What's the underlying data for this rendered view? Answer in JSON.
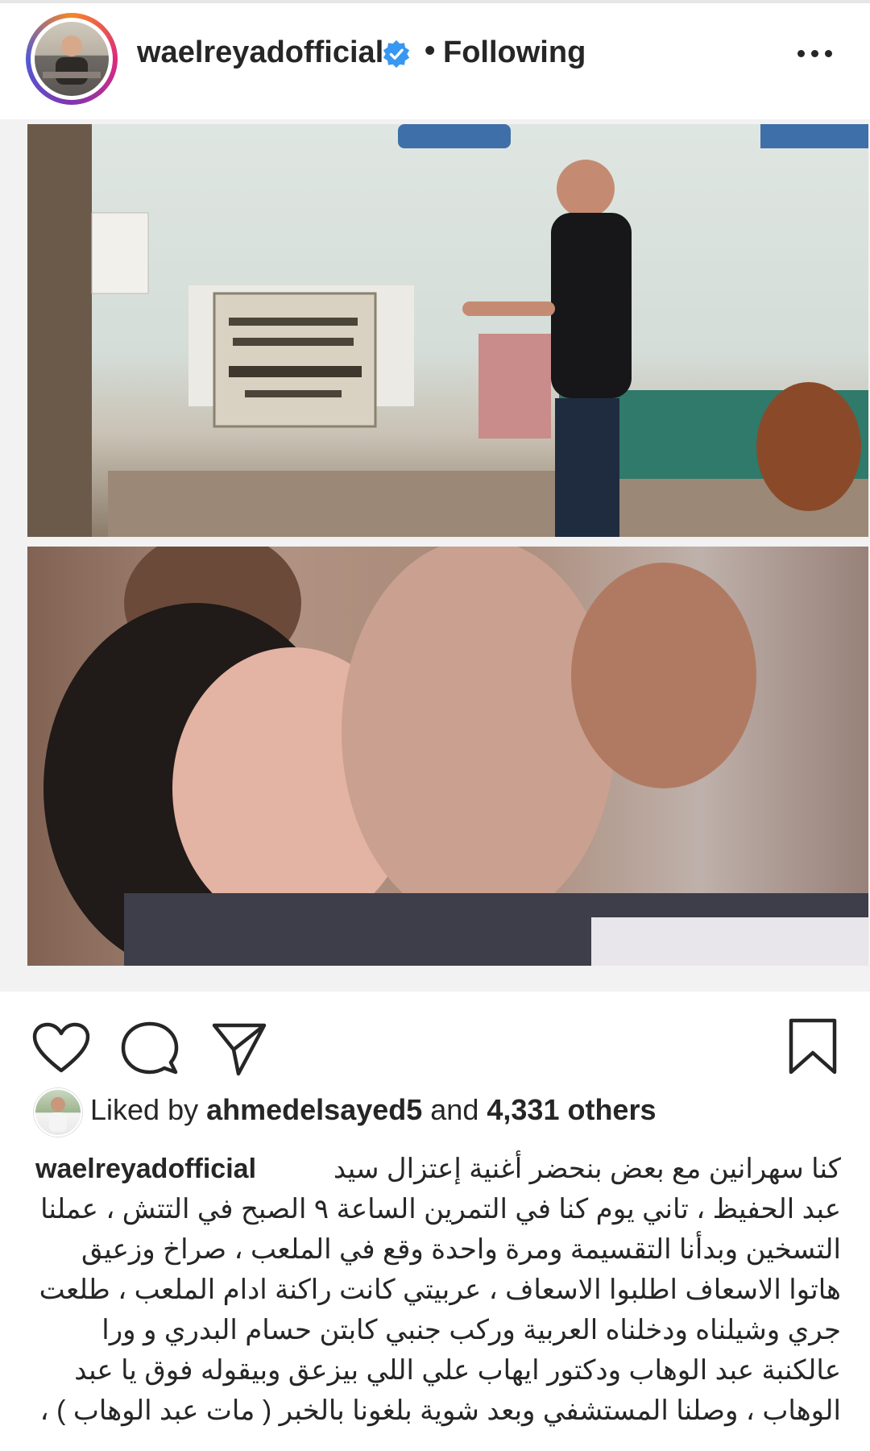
{
  "post": {
    "username": "waelreyadofficial",
    "separator": "•",
    "follow_status": "Following",
    "verified_icon": "verified-badge-icon",
    "more_icon": "more-options-icon"
  },
  "colors": {
    "verified": "#3897f0",
    "text": "#262626"
  },
  "actions": {
    "like_icon": "heart-icon",
    "comment_icon": "comment-icon",
    "share_icon": "send-icon",
    "save_icon": "bookmark-icon"
  },
  "likes": {
    "prefix": "Liked by",
    "user": "ahmedelsayed5",
    "joiner": "and",
    "count": "4,331 others"
  },
  "caption": {
    "username": "waelreyadofficial",
    "lines": [
      "كنا سهرانين مع بعض بنحضر أغنية إعتزال سيد",
      "عبد الحفيظ ، تاني يوم كنا في التمرين الساعة ٩ الصبح في التتش ، عملنا",
      "التسخين وبدأنا التقسيمة ومرة واحدة وقع في الملعب ، صراخ وزعيق",
      "هاتوا الاسعاف اطلبوا الاسعاف ، عربيتي كانت راكنة ادام الملعب ، طلعت",
      "جري وشيلناه ودخلناه العربية وركب جنبي كابتن حسام البدري و ورا",
      "عالكنبة عبد الوهاب ودكتور ايهاب علي اللي بيزعق وبيقوله فوق يا عبد",
      "الوهاب ، وصلنا المستشفي وبعد شوية بلغونا بالخبر ( مات عبد الوهاب ) ،"
    ]
  }
}
